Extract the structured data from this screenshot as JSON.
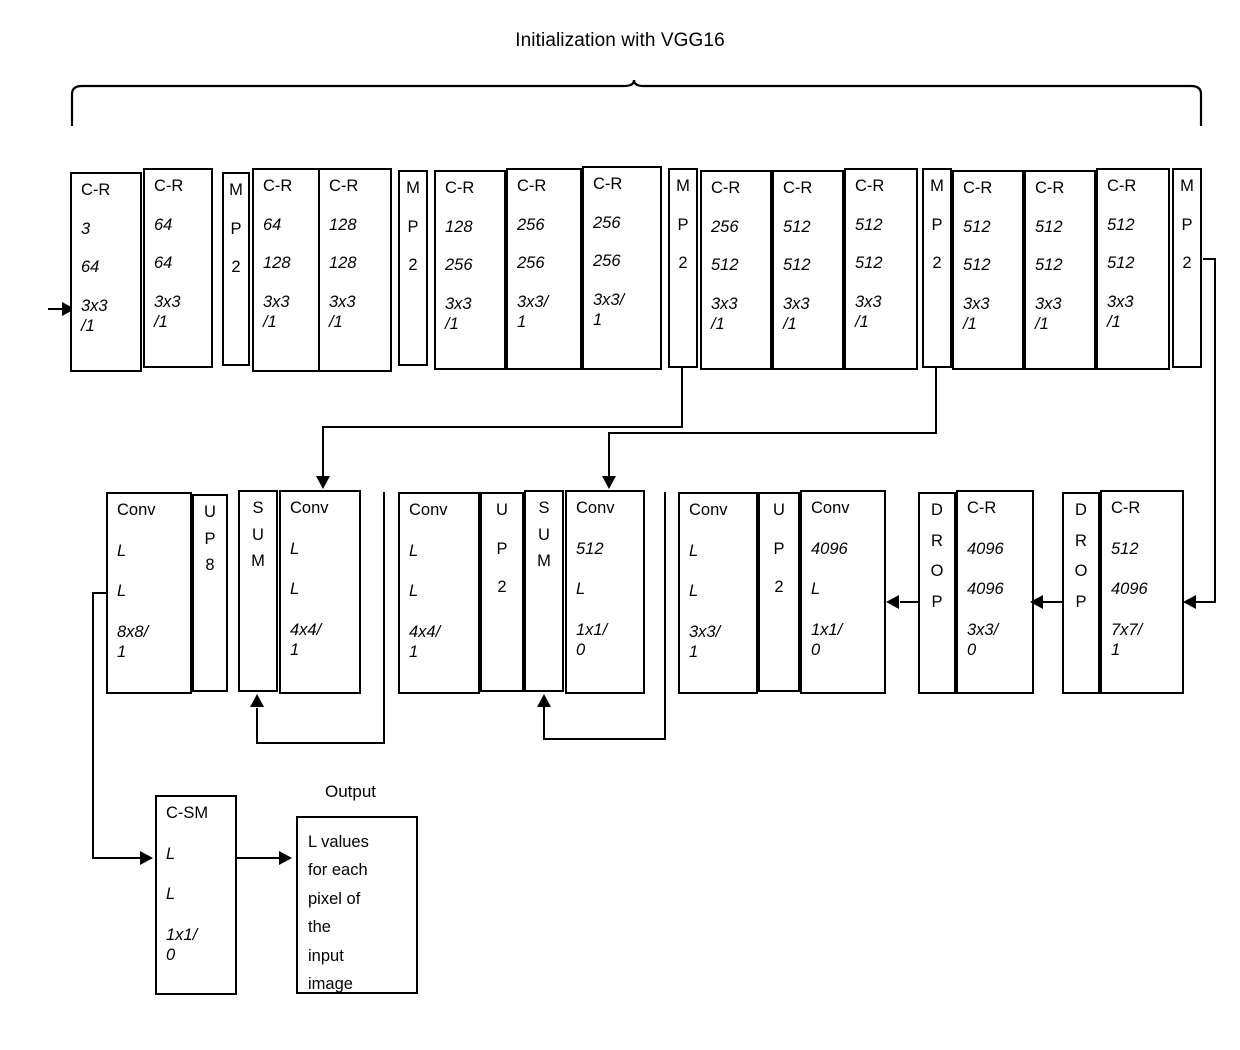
{
  "title": "Initialization with VGG16",
  "output_caption": "Output",
  "colors": {
    "stroke": "#000000",
    "background": "#ffffff"
  },
  "encoder_row": [
    {
      "id": "conv1_1",
      "type": "C-R",
      "lines": [
        "C-R",
        "3",
        "64",
        "3x3",
        "/1"
      ]
    },
    {
      "id": "conv1_2",
      "type": "C-R",
      "lines": [
        "C-R",
        "64",
        "64",
        "3x3",
        "/1"
      ]
    },
    {
      "id": "pool1",
      "type": "MP",
      "lines": [
        "M",
        "P",
        "2"
      ]
    },
    {
      "id": "conv2_1",
      "type": "C-R",
      "lines": [
        "C-R",
        "64",
        "128",
        "3x3",
        "/1"
      ]
    },
    {
      "id": "conv2_2",
      "type": "C-R",
      "lines": [
        "C-R",
        "128",
        "128",
        "3x3",
        "/1"
      ]
    },
    {
      "id": "pool2",
      "type": "MP",
      "lines": [
        "M",
        "P",
        "2"
      ]
    },
    {
      "id": "conv3_1",
      "type": "C-R",
      "lines": [
        "C-R",
        "128",
        "256",
        "3x3",
        "/1"
      ]
    },
    {
      "id": "conv3_2",
      "type": "C-R",
      "lines": [
        "C-R",
        "256",
        "256",
        "3x3/",
        "1"
      ]
    },
    {
      "id": "conv3_3",
      "type": "C-R",
      "lines": [
        "C-R",
        "256",
        "256",
        "3x3/",
        "1"
      ]
    },
    {
      "id": "pool3",
      "type": "MP",
      "lines": [
        "M",
        "P",
        "2"
      ]
    },
    {
      "id": "conv4_1",
      "type": "C-R",
      "lines": [
        "C-R",
        "256",
        "512",
        "3x3",
        "/1"
      ]
    },
    {
      "id": "conv4_2",
      "type": "C-R",
      "lines": [
        "C-R",
        "512",
        "512",
        "3x3",
        "/1"
      ]
    },
    {
      "id": "conv4_3",
      "type": "C-R",
      "lines": [
        "C-R",
        "512",
        "512",
        "3x3",
        "/1"
      ]
    },
    {
      "id": "pool4",
      "type": "MP",
      "lines": [
        "M",
        "P",
        "2"
      ]
    },
    {
      "id": "conv5_1",
      "type": "C-R",
      "lines": [
        "C-R",
        "512",
        "512",
        "3x3",
        "/1"
      ]
    },
    {
      "id": "conv5_2",
      "type": "C-R",
      "lines": [
        "C-R",
        "512",
        "512",
        "3x3",
        "/1"
      ]
    },
    {
      "id": "conv5_3",
      "type": "C-R",
      "lines": [
        "C-R",
        "512",
        "512",
        "3x3",
        "/1"
      ]
    },
    {
      "id": "pool5",
      "type": "MP",
      "lines": [
        "M",
        "P",
        "2"
      ]
    }
  ],
  "decoder_row": [
    {
      "id": "conv_skip3",
      "type": "Conv",
      "lines": [
        "Conv",
        "L",
        "L",
        "8x8/",
        "1"
      ]
    },
    {
      "id": "up8",
      "type": "UP",
      "lines": [
        "U",
        "P",
        "8"
      ]
    },
    {
      "id": "sum_left",
      "type": "SUM",
      "lines": [
        "S",
        "U",
        "M"
      ]
    },
    {
      "id": "conv_s3",
      "type": "Conv",
      "lines": [
        "Conv",
        "L",
        "L",
        "4x4/",
        "1"
      ]
    },
    {
      "id": "conv_skip4",
      "type": "Conv",
      "lines": [
        "Conv",
        "L",
        "L",
        "4x4/",
        "1"
      ]
    },
    {
      "id": "up2_a",
      "type": "UP",
      "lines": [
        "U",
        "P",
        "2"
      ]
    },
    {
      "id": "sum_mid",
      "type": "SUM",
      "lines": [
        "S",
        "U",
        "M"
      ]
    },
    {
      "id": "conv_s4",
      "type": "Conv",
      "lines": [
        "Conv",
        "512",
        "L",
        "1x1/",
        "0"
      ]
    },
    {
      "id": "conv_skip5",
      "type": "Conv",
      "lines": [
        "Conv",
        "L",
        "L",
        "3x3/",
        "1"
      ]
    },
    {
      "id": "up2_b",
      "type": "UP",
      "lines": [
        "U",
        "P",
        "2"
      ]
    },
    {
      "id": "conv_score",
      "type": "Conv",
      "lines": [
        "Conv",
        "4096",
        "L",
        "1x1/",
        "0"
      ]
    },
    {
      "id": "drop_a",
      "type": "DROP",
      "lines": [
        "D",
        "R",
        "O",
        "P"
      ]
    },
    {
      "id": "fc7",
      "type": "C-R",
      "lines": [
        "C-R",
        "4096",
        "4096",
        "3x3/",
        "0"
      ]
    },
    {
      "id": "drop_b",
      "type": "DROP",
      "lines": [
        "D",
        "R",
        "O",
        "P"
      ]
    },
    {
      "id": "fc6",
      "type": "C-R",
      "lines": [
        "C-R",
        "512",
        "4096",
        "7x7/",
        "1"
      ]
    }
  ],
  "softmax_block": {
    "id": "c_sm",
    "type": "C-SM",
    "lines": [
      "C-SM",
      "L",
      "L",
      "1x1/",
      "0"
    ]
  },
  "output_block": {
    "id": "output",
    "lines": [
      "L values",
      "for each",
      "pixel of",
      "the",
      "input",
      "image"
    ]
  }
}
